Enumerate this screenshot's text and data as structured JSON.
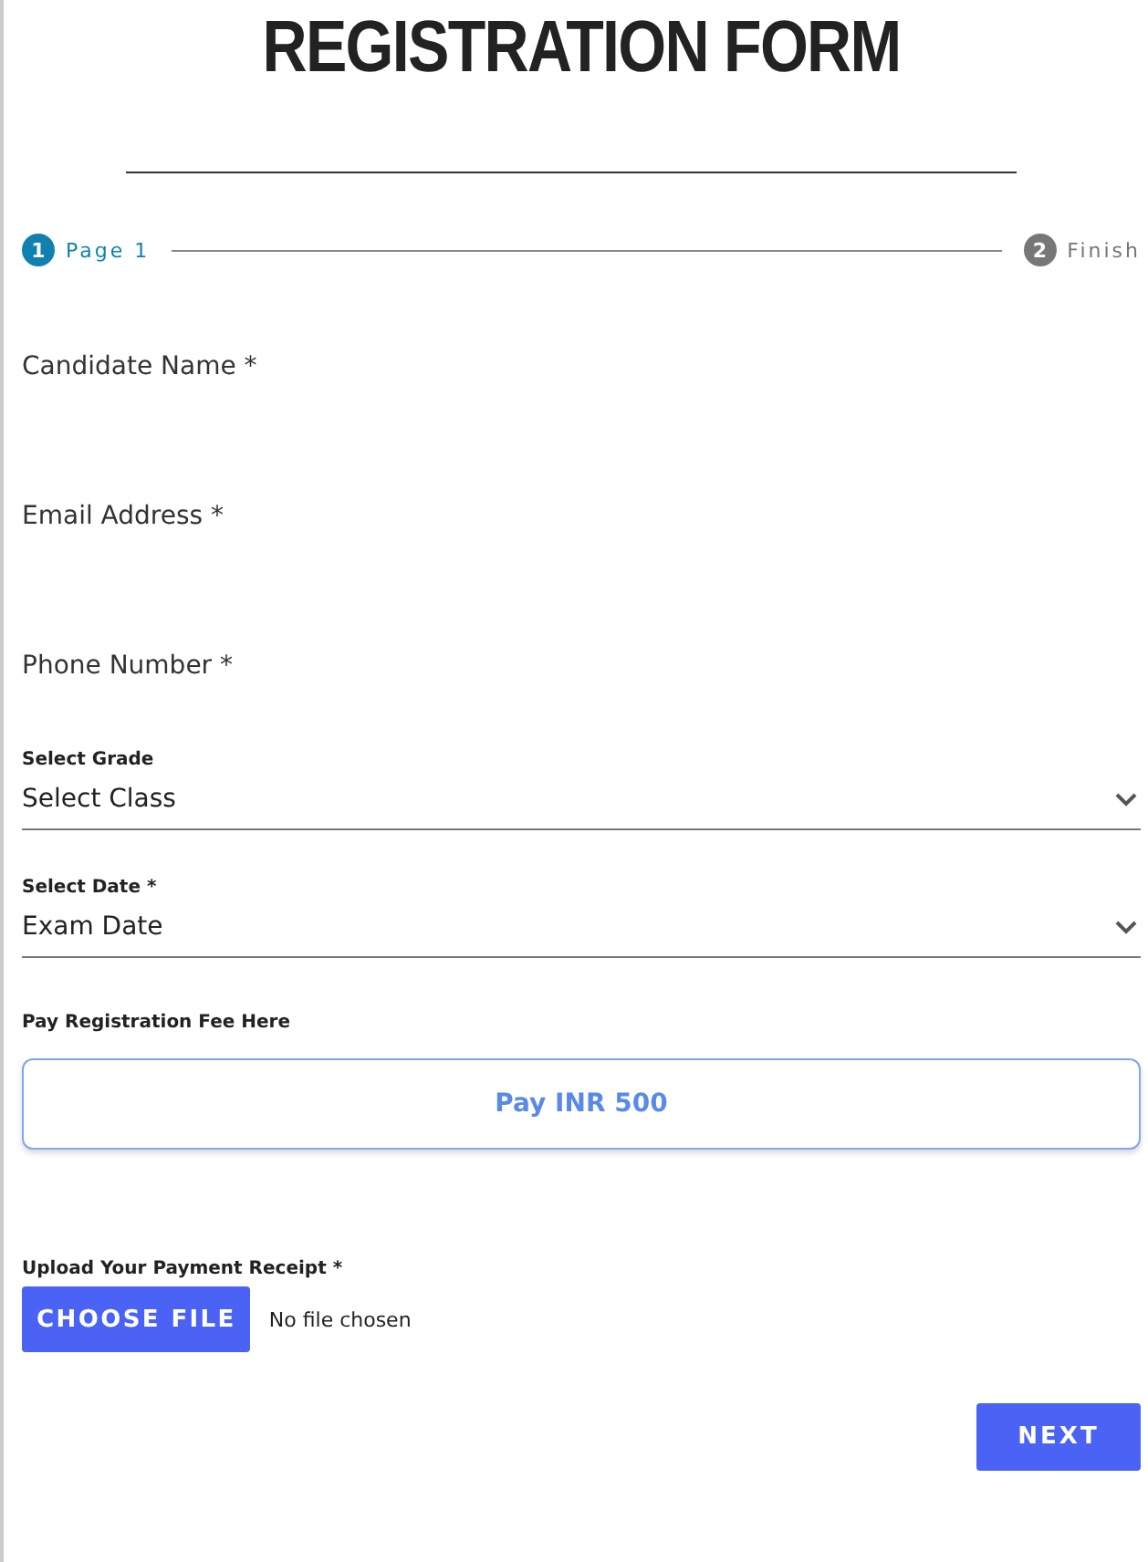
{
  "title": "REGISTRATION FORM",
  "steps": [
    {
      "number": "1",
      "label": "Page 1",
      "selected": true
    },
    {
      "number": "2",
      "label": "Finish",
      "selected": false
    }
  ],
  "text_fields": [
    {
      "placeholder": "Candidate Name *"
    },
    {
      "placeholder": "Email Address *"
    },
    {
      "placeholder": "Phone Number *"
    }
  ],
  "selects": [
    {
      "label": "Select Grade",
      "value": "Select Class"
    },
    {
      "label": "Select Date *",
      "value": "Exam Date"
    }
  ],
  "payment": {
    "label": "Pay Registration Fee Here",
    "button": "Pay INR 500"
  },
  "upload": {
    "label": "Upload Your Payment Receipt *",
    "button": "CHOOSE FILE",
    "status": "No file chosen"
  },
  "next_button": "NEXT"
}
